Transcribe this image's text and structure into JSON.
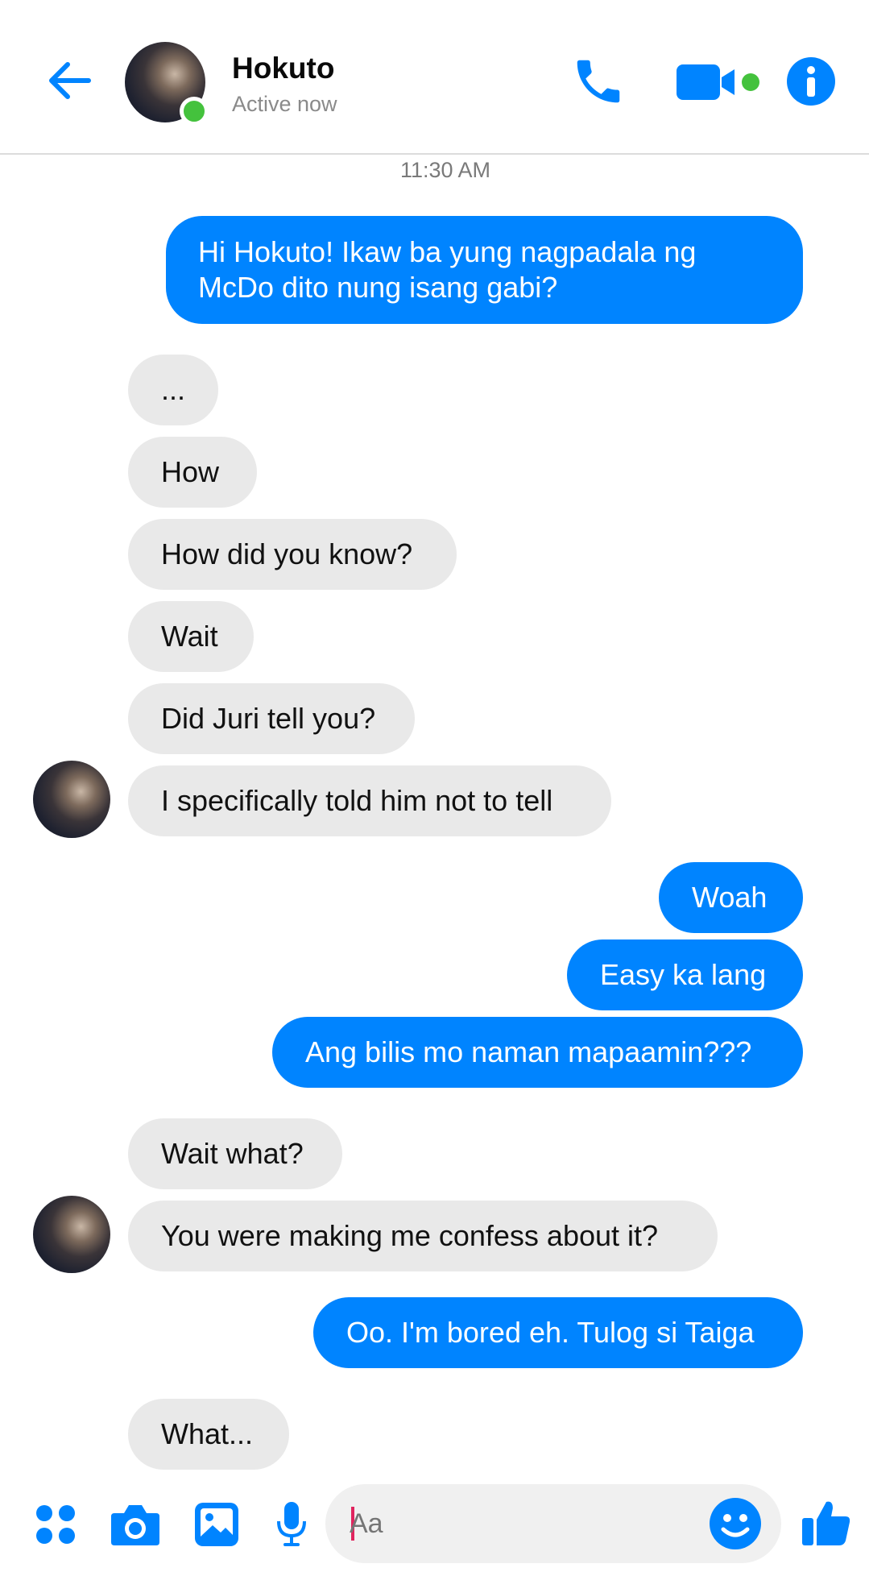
{
  "header": {
    "contact_name": "Hokuto",
    "status": "Active now"
  },
  "conversation": {
    "timestamp": "11:30 AM",
    "messages": [
      {
        "sender": "me",
        "text": "Hi Hokuto! Ikaw ba yung nagpadala ng McDo dito nung isang gabi?"
      },
      {
        "sender": "them",
        "text": "..."
      },
      {
        "sender": "them",
        "text": "How"
      },
      {
        "sender": "them",
        "text": "How did you know?"
      },
      {
        "sender": "them",
        "text": "Wait"
      },
      {
        "sender": "them",
        "text": "Did Juri tell you?"
      },
      {
        "sender": "them",
        "text": "I specifically told him not to tell"
      },
      {
        "sender": "me",
        "text": "Woah"
      },
      {
        "sender": "me",
        "text": "Easy ka lang"
      },
      {
        "sender": "me",
        "text": "Ang bilis mo naman mapaamin???"
      },
      {
        "sender": "them",
        "text": "Wait what?"
      },
      {
        "sender": "them",
        "text": "You were making me confess about it?"
      },
      {
        "sender": "me",
        "text": "Oo. I'm bored eh. Tulog si Taiga"
      },
      {
        "sender": "them",
        "text": "What..."
      }
    ]
  },
  "composer": {
    "placeholder": "Aa"
  },
  "colors": {
    "accent": "#0084ff",
    "incoming_bubble": "#e9e9e9",
    "presence": "#44c23d"
  },
  "icons": [
    "back-arrow-icon",
    "phone-icon",
    "video-camera-icon",
    "info-icon",
    "apps-icon",
    "camera-icon",
    "gallery-icon",
    "microphone-icon",
    "emoji-icon",
    "thumbs-up-icon"
  ]
}
